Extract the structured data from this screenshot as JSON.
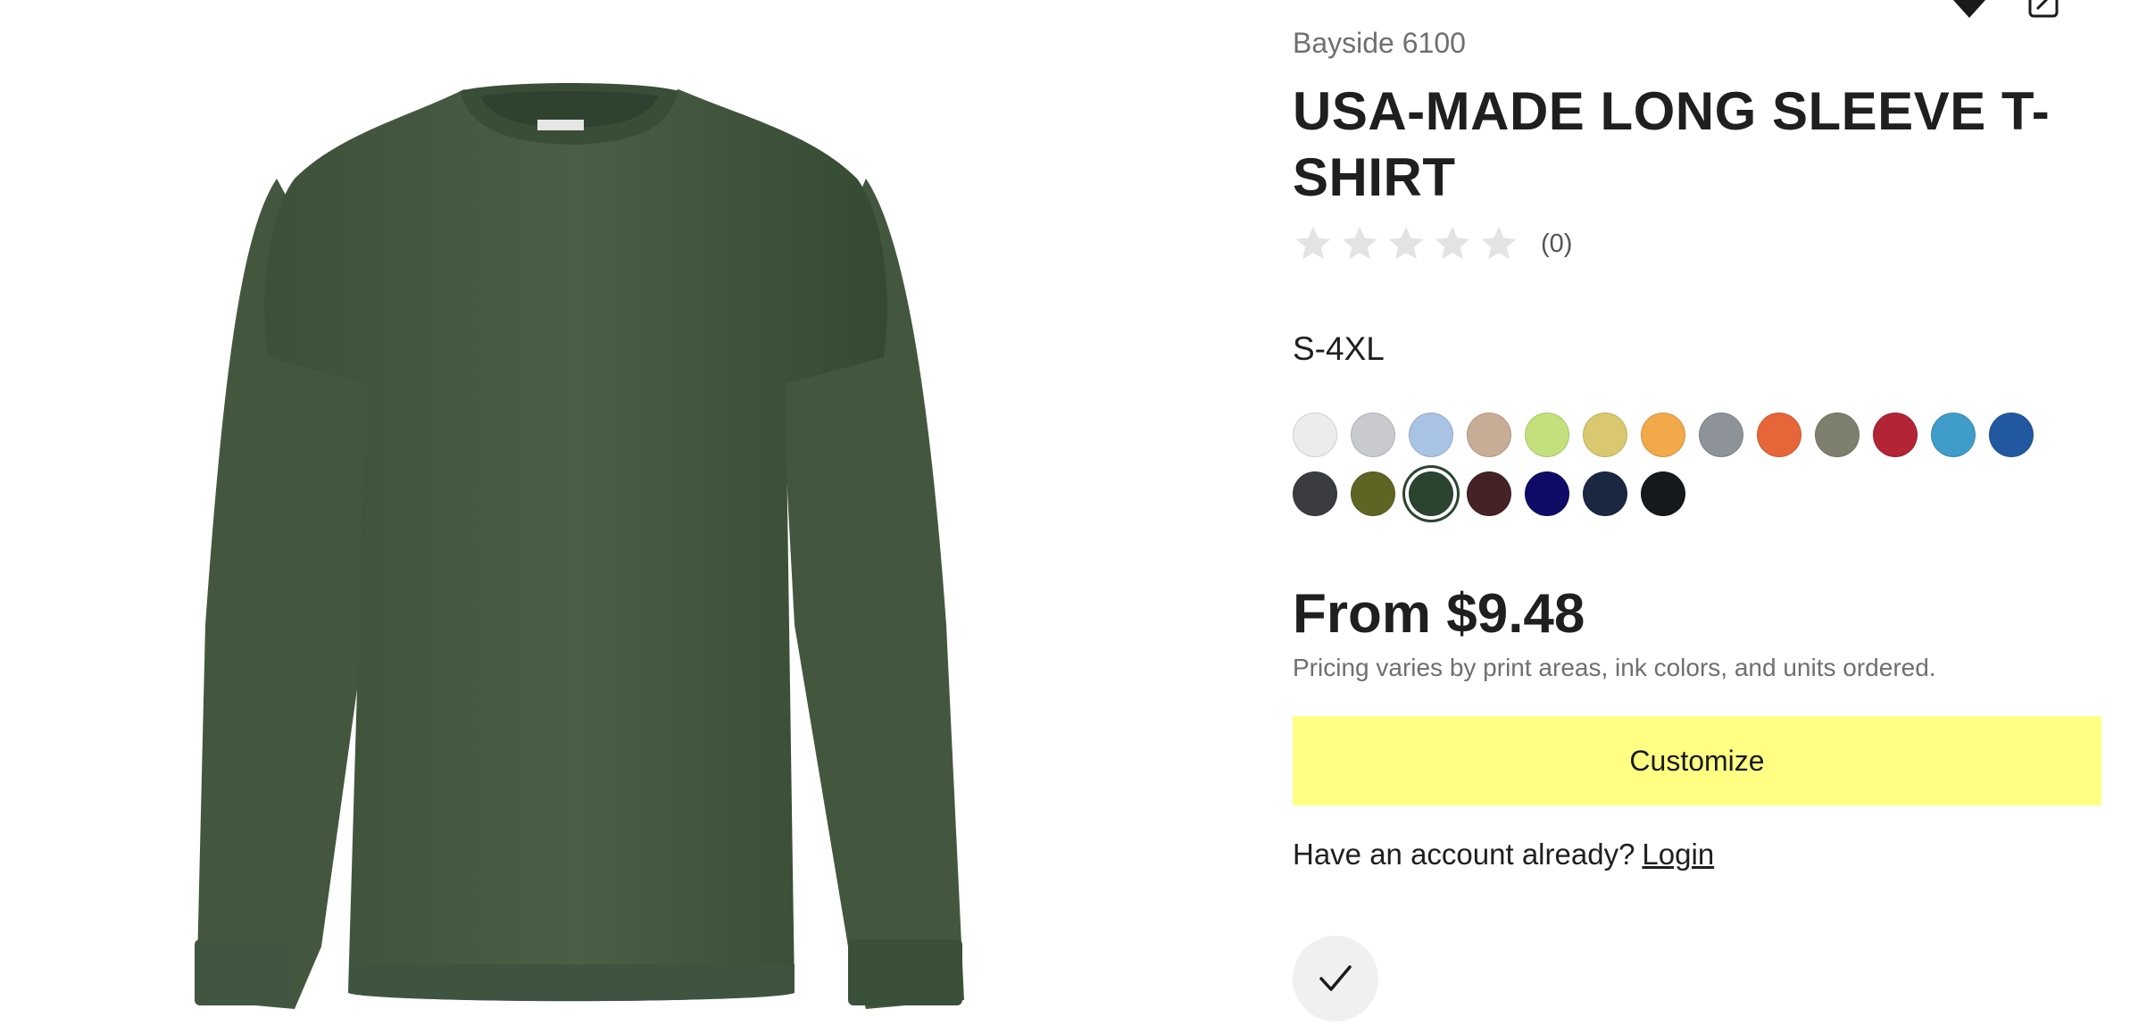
{
  "product": {
    "brand": "Bayside 6100",
    "title": "USA-MADE LONG SLEEVE T-SHIRT",
    "rating": {
      "stars": 0,
      "max_stars": 5,
      "count_label": "(0)"
    },
    "sizes": "S-4XL",
    "price": "From $9.48",
    "pricing_note": "Pricing varies by print areas, ink colors, and units ordered.",
    "shirt_color": "#43573f"
  },
  "swatches": [
    {
      "color": "#ececec",
      "selected": false
    },
    {
      "color": "#c9cacf",
      "selected": false
    },
    {
      "color": "#a9c3e4",
      "selected": false
    },
    {
      "color": "#c8ad96",
      "selected": false
    },
    {
      "color": "#c3e07c",
      "selected": false
    },
    {
      "color": "#d9c86f",
      "selected": false
    },
    {
      "color": "#f2a94a",
      "selected": false
    },
    {
      "color": "#8e9399",
      "selected": false
    },
    {
      "color": "#e6663a",
      "selected": false
    },
    {
      "color": "#7e7f6e",
      "selected": false
    },
    {
      "color": "#b32436",
      "selected": false
    },
    {
      "color": "#3f9cc9",
      "selected": false
    },
    {
      "color": "#22589f",
      "selected": false
    },
    {
      "color": "#3b3c40",
      "selected": false
    },
    {
      "color": "#5e6423",
      "selected": false
    },
    {
      "color": "#2b4430",
      "selected": true
    },
    {
      "color": "#452226",
      "selected": false
    },
    {
      "color": "#0e0c66",
      "selected": false
    },
    {
      "color": "#1b2640",
      "selected": false
    },
    {
      "color": "#16191b",
      "selected": false
    }
  ],
  "actions": {
    "customize_label": "Customize",
    "account_prompt": "Have an account already?",
    "login_label": "Login"
  },
  "icons": {
    "favorite": "heart-icon",
    "edit": "edit-icon",
    "check": "check-icon",
    "star": "star-icon"
  },
  "colors": {
    "cta_background": "#ffff84",
    "star_empty": "#e3e3e3",
    "muted_text": "#6f6f6f"
  }
}
